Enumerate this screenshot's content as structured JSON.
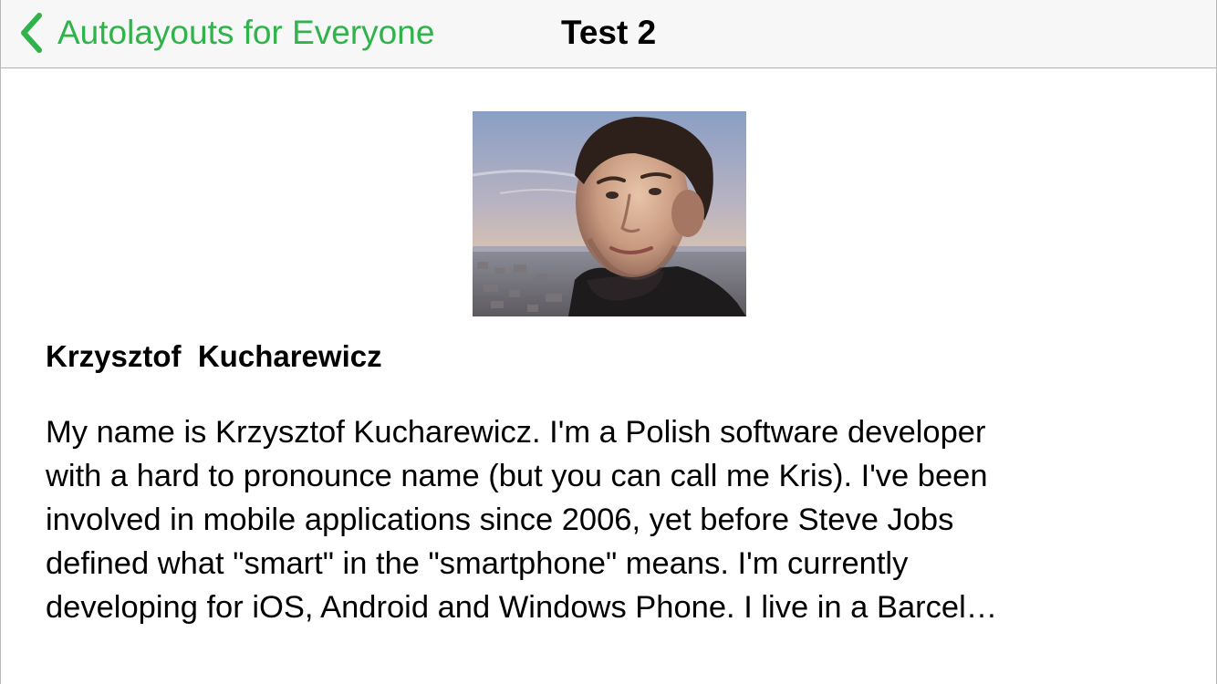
{
  "colors": {
    "tint": "#2fb34a",
    "navbar_bg": "#f7f7f7",
    "text": "#000000"
  },
  "nav": {
    "back_label": "Autolayouts for Everyone",
    "back_icon": "chevron-left-icon",
    "title": "Test 2"
  },
  "profile": {
    "photo": "avatar-photo",
    "name": "Krzysztof  Kucharewicz",
    "bio_lines": [
      "My name is Krzysztof Kucharewicz. I'm a Polish software developer",
      "with a hard to pronounce name (but you can call me Kris). I've been",
      "involved in mobile applications since 2006, yet before Steve Jobs",
      "defined what \"smart\" in the \"smartphone\" means. I'm currently",
      "developing for iOS, Android and Windows Phone. I live in a Barcel…"
    ]
  }
}
